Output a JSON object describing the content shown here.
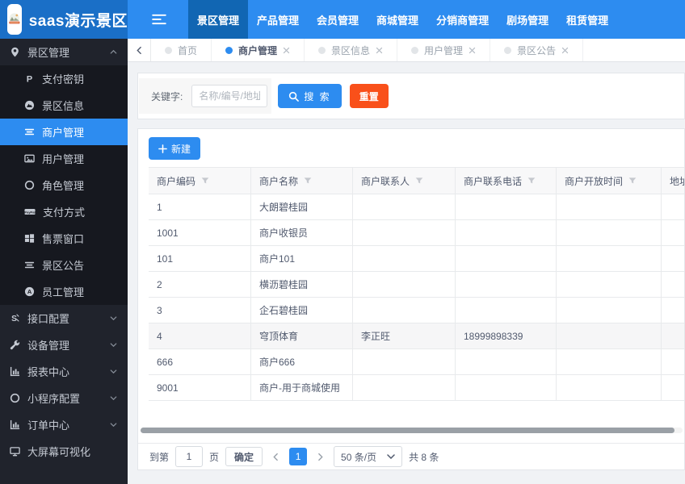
{
  "app": {
    "title": "saas演示景区"
  },
  "topnav": {
    "items": [
      {
        "label": "景区管理",
        "active": true
      },
      {
        "label": "产品管理",
        "active": false
      },
      {
        "label": "会员管理",
        "active": false
      },
      {
        "label": "商城管理",
        "active": false
      },
      {
        "label": "分销商管理",
        "active": false
      },
      {
        "label": "剧场管理",
        "active": false
      },
      {
        "label": "租赁管理",
        "active": false
      }
    ]
  },
  "sidebar": {
    "sections": [
      {
        "label": "景区管理",
        "icon": "location-icon",
        "state": "expanded",
        "children": [
          {
            "label": "支付密钥",
            "icon": "paypal-icon",
            "active": false
          },
          {
            "label": "景区信息",
            "icon": "mountain-icon",
            "active": false
          },
          {
            "label": "商户管理",
            "icon": "list-icon",
            "active": true
          },
          {
            "label": "用户管理",
            "icon": "image-icon",
            "active": false
          },
          {
            "label": "角色管理",
            "icon": "circle-icon",
            "active": false
          },
          {
            "label": "支付方式",
            "icon": "paypal-badge-icon",
            "active": false
          },
          {
            "label": "售票窗口",
            "icon": "windows-icon",
            "active": false
          },
          {
            "label": "景区公告",
            "icon": "list-icon",
            "active": false
          },
          {
            "label": "员工管理",
            "icon": "user-circle-icon",
            "active": false
          }
        ]
      },
      {
        "label": "接口配置",
        "icon": "api-icon",
        "state": "collapsed"
      },
      {
        "label": "设备管理",
        "icon": "wrench-icon",
        "state": "collapsed"
      },
      {
        "label": "报表中心",
        "icon": "chart-icon",
        "state": "collapsed"
      },
      {
        "label": "小程序配置",
        "icon": "circle-icon",
        "state": "collapsed"
      },
      {
        "label": "订单中心",
        "icon": "chart-icon",
        "state": "collapsed"
      },
      {
        "label": "大屏幕可视化",
        "icon": "monitor-icon",
        "state": "none"
      }
    ]
  },
  "tabbar": {
    "tabs": [
      {
        "label": "首页",
        "active": false,
        "closable": false
      },
      {
        "label": "商户管理",
        "active": true,
        "closable": true
      },
      {
        "label": "景区信息",
        "active": false,
        "closable": true
      },
      {
        "label": "用户管理",
        "active": false,
        "closable": true
      },
      {
        "label": "景区公告",
        "active": false,
        "closable": true
      }
    ]
  },
  "search": {
    "label": "关键字:",
    "placeholder": "名称/编号/地址",
    "search_label": "搜 索",
    "reset_label": "重置"
  },
  "toolbar": {
    "new_label": "新建"
  },
  "table": {
    "columns": [
      {
        "label": "商户编码",
        "filter": true
      },
      {
        "label": "商户名称",
        "filter": true
      },
      {
        "label": "商户联系人",
        "filter": true
      },
      {
        "label": "商户联系电话",
        "filter": true
      },
      {
        "label": "商户开放时间",
        "filter": true
      },
      {
        "label": "地址",
        "filter": false
      }
    ],
    "rows": [
      {
        "cells": [
          "1",
          "大朗碧桂园",
          "",
          "",
          "",
          ""
        ],
        "highlight": false
      },
      {
        "cells": [
          "1001",
          "商户收银员",
          "",
          "",
          "",
          ""
        ],
        "highlight": false
      },
      {
        "cells": [
          "101",
          "商户101",
          "",
          "",
          "",
          ""
        ],
        "highlight": false
      },
      {
        "cells": [
          "2",
          "横沥碧桂园",
          "",
          "",
          "",
          ""
        ],
        "highlight": false
      },
      {
        "cells": [
          "3",
          "企石碧桂园",
          "",
          "",
          "",
          ""
        ],
        "highlight": false
      },
      {
        "cells": [
          "4",
          "穹顶体育",
          "李正旺",
          "18999898339",
          "",
          ""
        ],
        "highlight": true
      },
      {
        "cells": [
          "666",
          "商户666",
          "",
          "",
          "",
          ""
        ],
        "highlight": false
      },
      {
        "cells": [
          "9001",
          "商户-用于商城使用",
          "",
          "",
          "",
          ""
        ],
        "highlight": false
      }
    ]
  },
  "pagination": {
    "goto_prefix": "到第",
    "goto_value": "1",
    "goto_suffix": "页",
    "confirm_label": "确定",
    "current_page": "1",
    "page_size_label": "50 条/页",
    "total_label": "共 8 条"
  },
  "colors": {
    "primary": "#2d8cf0",
    "topbar": "#2d8cf0",
    "logo_zone": "#1a6fc7",
    "nav_active": "#1166b3",
    "sidebar": "#20232c",
    "submenu": "#16181f",
    "reset_button": "#f9501a"
  }
}
